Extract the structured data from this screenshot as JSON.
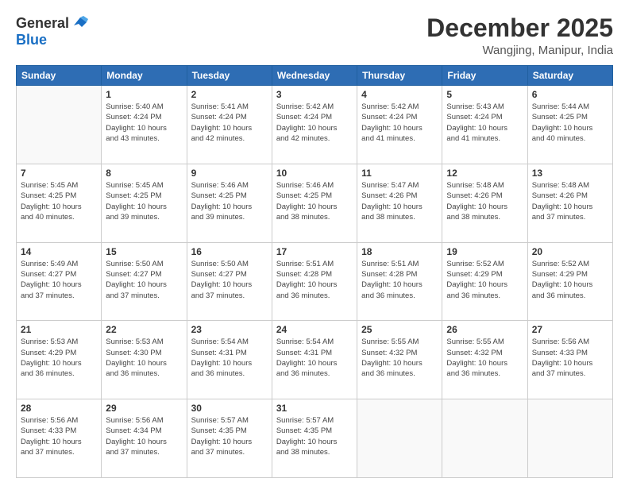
{
  "header": {
    "logo_general": "General",
    "logo_blue": "Blue",
    "month_title": "December 2025",
    "location": "Wangjing, Manipur, India"
  },
  "days_of_week": [
    "Sunday",
    "Monday",
    "Tuesday",
    "Wednesday",
    "Thursday",
    "Friday",
    "Saturday"
  ],
  "weeks": [
    [
      {
        "day": "",
        "info": ""
      },
      {
        "day": "1",
        "info": "Sunrise: 5:40 AM\nSunset: 4:24 PM\nDaylight: 10 hours\nand 43 minutes."
      },
      {
        "day": "2",
        "info": "Sunrise: 5:41 AM\nSunset: 4:24 PM\nDaylight: 10 hours\nand 42 minutes."
      },
      {
        "day": "3",
        "info": "Sunrise: 5:42 AM\nSunset: 4:24 PM\nDaylight: 10 hours\nand 42 minutes."
      },
      {
        "day": "4",
        "info": "Sunrise: 5:42 AM\nSunset: 4:24 PM\nDaylight: 10 hours\nand 41 minutes."
      },
      {
        "day": "5",
        "info": "Sunrise: 5:43 AM\nSunset: 4:24 PM\nDaylight: 10 hours\nand 41 minutes."
      },
      {
        "day": "6",
        "info": "Sunrise: 5:44 AM\nSunset: 4:25 PM\nDaylight: 10 hours\nand 40 minutes."
      }
    ],
    [
      {
        "day": "7",
        "info": "Sunrise: 5:45 AM\nSunset: 4:25 PM\nDaylight: 10 hours\nand 40 minutes."
      },
      {
        "day": "8",
        "info": "Sunrise: 5:45 AM\nSunset: 4:25 PM\nDaylight: 10 hours\nand 39 minutes."
      },
      {
        "day": "9",
        "info": "Sunrise: 5:46 AM\nSunset: 4:25 PM\nDaylight: 10 hours\nand 39 minutes."
      },
      {
        "day": "10",
        "info": "Sunrise: 5:46 AM\nSunset: 4:25 PM\nDaylight: 10 hours\nand 38 minutes."
      },
      {
        "day": "11",
        "info": "Sunrise: 5:47 AM\nSunset: 4:26 PM\nDaylight: 10 hours\nand 38 minutes."
      },
      {
        "day": "12",
        "info": "Sunrise: 5:48 AM\nSunset: 4:26 PM\nDaylight: 10 hours\nand 38 minutes."
      },
      {
        "day": "13",
        "info": "Sunrise: 5:48 AM\nSunset: 4:26 PM\nDaylight: 10 hours\nand 37 minutes."
      }
    ],
    [
      {
        "day": "14",
        "info": "Sunrise: 5:49 AM\nSunset: 4:27 PM\nDaylight: 10 hours\nand 37 minutes."
      },
      {
        "day": "15",
        "info": "Sunrise: 5:50 AM\nSunset: 4:27 PM\nDaylight: 10 hours\nand 37 minutes."
      },
      {
        "day": "16",
        "info": "Sunrise: 5:50 AM\nSunset: 4:27 PM\nDaylight: 10 hours\nand 37 minutes."
      },
      {
        "day": "17",
        "info": "Sunrise: 5:51 AM\nSunset: 4:28 PM\nDaylight: 10 hours\nand 36 minutes."
      },
      {
        "day": "18",
        "info": "Sunrise: 5:51 AM\nSunset: 4:28 PM\nDaylight: 10 hours\nand 36 minutes."
      },
      {
        "day": "19",
        "info": "Sunrise: 5:52 AM\nSunset: 4:29 PM\nDaylight: 10 hours\nand 36 minutes."
      },
      {
        "day": "20",
        "info": "Sunrise: 5:52 AM\nSunset: 4:29 PM\nDaylight: 10 hours\nand 36 minutes."
      }
    ],
    [
      {
        "day": "21",
        "info": "Sunrise: 5:53 AM\nSunset: 4:29 PM\nDaylight: 10 hours\nand 36 minutes."
      },
      {
        "day": "22",
        "info": "Sunrise: 5:53 AM\nSunset: 4:30 PM\nDaylight: 10 hours\nand 36 minutes."
      },
      {
        "day": "23",
        "info": "Sunrise: 5:54 AM\nSunset: 4:31 PM\nDaylight: 10 hours\nand 36 minutes."
      },
      {
        "day": "24",
        "info": "Sunrise: 5:54 AM\nSunset: 4:31 PM\nDaylight: 10 hours\nand 36 minutes."
      },
      {
        "day": "25",
        "info": "Sunrise: 5:55 AM\nSunset: 4:32 PM\nDaylight: 10 hours\nand 36 minutes."
      },
      {
        "day": "26",
        "info": "Sunrise: 5:55 AM\nSunset: 4:32 PM\nDaylight: 10 hours\nand 36 minutes."
      },
      {
        "day": "27",
        "info": "Sunrise: 5:56 AM\nSunset: 4:33 PM\nDaylight: 10 hours\nand 37 minutes."
      }
    ],
    [
      {
        "day": "28",
        "info": "Sunrise: 5:56 AM\nSunset: 4:33 PM\nDaylight: 10 hours\nand 37 minutes."
      },
      {
        "day": "29",
        "info": "Sunrise: 5:56 AM\nSunset: 4:34 PM\nDaylight: 10 hours\nand 37 minutes."
      },
      {
        "day": "30",
        "info": "Sunrise: 5:57 AM\nSunset: 4:35 PM\nDaylight: 10 hours\nand 37 minutes."
      },
      {
        "day": "31",
        "info": "Sunrise: 5:57 AM\nSunset: 4:35 PM\nDaylight: 10 hours\nand 38 minutes."
      },
      {
        "day": "",
        "info": ""
      },
      {
        "day": "",
        "info": ""
      },
      {
        "day": "",
        "info": ""
      }
    ]
  ]
}
